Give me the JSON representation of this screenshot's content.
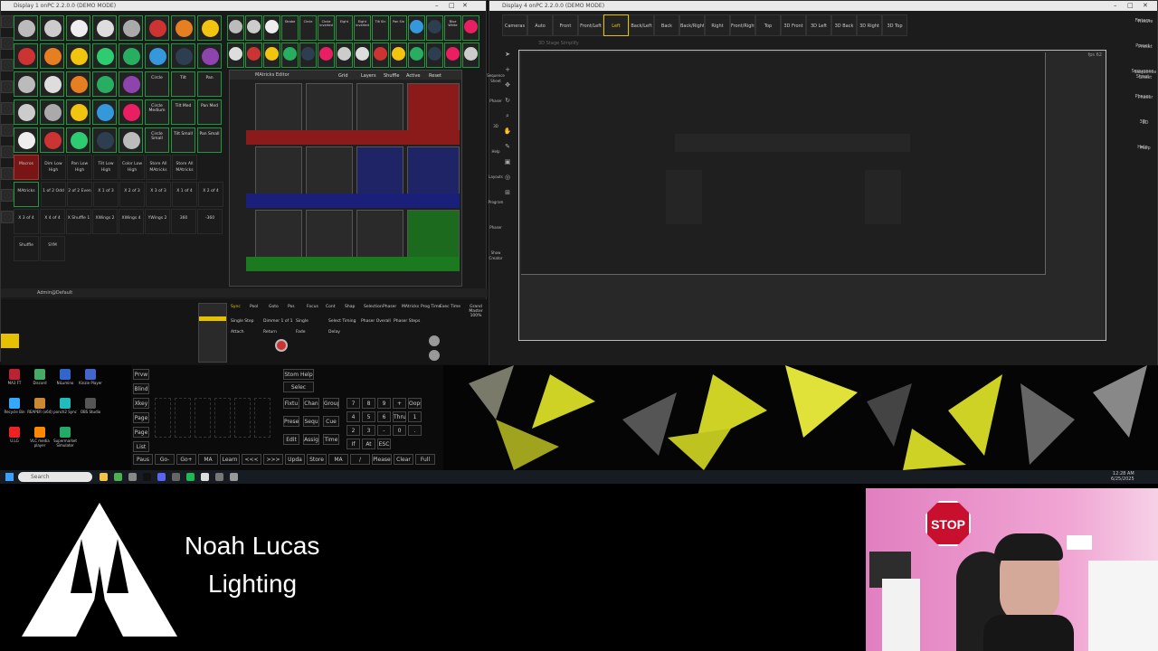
{
  "win1": {
    "title": "Display 1 onPC 2.2.0.0 (DEMO MODE)"
  },
  "top_row1": [
    "",
    "",
    "",
    "Strobe",
    "Circle",
    "Circle inverted",
    "Eight",
    "Eight inverted",
    "Tilt Sin",
    "Pan Sin",
    "",
    "",
    "Blue White",
    ""
  ],
  "macros_row": [
    "Dim Low High",
    "Pan Low High",
    "Tilt Low High",
    "Color Low High",
    "Store All MAtricks",
    "Store All MAtricks"
  ],
  "macros_label": "Macros",
  "matricks_row1": [
    "1 of 2 Odd",
    "2 of 2 Even",
    "X 1 of 3",
    "X 2 of 3",
    "X 3 of 3",
    "X 1 of 4",
    "X 2 of 4"
  ],
  "matricks_row2": [
    "X 3 of 4",
    "X 4 of 4",
    "X Shuffle 1",
    "XWings 2",
    "XWings 4",
    "YWings 2",
    "360",
    "-360"
  ],
  "matricks_label": "MAtricks",
  "shuffle": [
    "Shuffle",
    "SYM"
  ],
  "preset_row3": [
    "Circle",
    "Tilt",
    "Pan"
  ],
  "preset_row4": [
    "Circle Medium",
    "Tilt Med",
    "Pan Med"
  ],
  "preset_row5": [
    "Circle Small",
    "Tilt Small",
    "Pan Small"
  ],
  "matricks_editor": {
    "title": "MAtricks Editor",
    "tabs": [
      "Grid",
      "Layers",
      "Shuffle",
      "Active",
      "Reset"
    ]
  },
  "cmdline": "Admin@Default",
  "exec": {
    "tabs": [
      "Sync",
      "Pool",
      "Goto",
      "Pos",
      "Focus",
      "Cont",
      "Shap",
      "Selection",
      "Phaser",
      "MAtricks",
      "Prog Time",
      "Exec Time"
    ],
    "items": [
      "Single Step",
      "Dimmer 1 of 1",
      "Single",
      "Select Timing",
      "Phaser Overall",
      "Phaser Steps",
      "Attach",
      "Return",
      "Fade",
      "Delay"
    ]
  },
  "grand": "Grand Master 100%",
  "win2": {
    "title": "Display 4 onPC 2.2.0.0 (DEMO MODE)"
  },
  "view_tabs": [
    "Cameras",
    "Auto",
    "Front",
    "Front/Left",
    "Left",
    "Back/Left",
    "Back",
    "Back/Right",
    "Right",
    "Front/Right",
    "Top",
    "3D Front",
    "3D Left",
    "3D Back",
    "3D Right",
    "3D Top"
  ],
  "selected_view": "Left",
  "viewport_header": "3D Stage Simplify",
  "fps": "fps 62",
  "right_menu": [
    "Fixture",
    "Preset",
    "Sequence Sheet",
    "Phaser",
    "3D",
    "Help"
  ],
  "right_menu2": [
    "Fixture",
    "Preset",
    "Sequence Sheet",
    "Phaser",
    "3D",
    "Help"
  ],
  "left_menu": [
    "Sequence Sheet",
    "Phaser",
    "3D",
    "Help",
    "Layouts",
    "Program",
    "Phaser",
    "Show Creator"
  ],
  "desktop_icons": [
    "MA3 FT",
    "Discord",
    "NiLumino",
    "Kinzie Player",
    "Recycle Bin",
    "REAPER (x64)",
    "ponch2 Sync",
    "OBS Studio",
    "U.LG",
    "VLC media player",
    "Supermarket Simulator"
  ],
  "keypad": {
    "left": [
      "Prvw",
      "Blind",
      "Xkey",
      "Page",
      "Page",
      "List"
    ],
    "row_ops": [
      "Stom Help",
      "Selec Goto"
    ],
    "fx": [
      "Fixtu",
      "Chan",
      "Group"
    ],
    "ops": [
      "Prese",
      "Sequ",
      "Cue"
    ],
    "edit": [
      "Edit",
      "Assig",
      "Time"
    ],
    "bottom": [
      "Paus",
      "Go-",
      "Go+",
      "MA",
      "Learn",
      "<<<",
      ">>>",
      "Upda",
      "Store",
      "MA",
      "/",
      "Please",
      "Clear",
      "Full"
    ],
    "nums": [
      "7",
      "8",
      "9",
      "+",
      "Oops",
      "4",
      "5",
      "6",
      "Thru",
      "1",
      "2",
      "3",
      "-",
      "0",
      ".",
      "If",
      "At",
      "ESC"
    ]
  },
  "taskbar": {
    "search": "Search",
    "time": "12:28 AM",
    "date": "6/25/2025"
  },
  "brand": {
    "line1": "Noah Lucas",
    "line2": "Lighting"
  },
  "webcam": {
    "sign": "STOP"
  }
}
